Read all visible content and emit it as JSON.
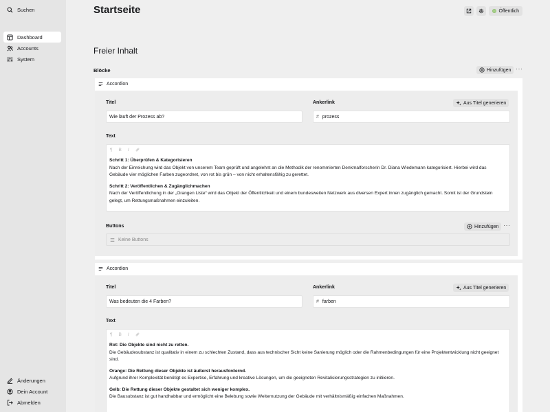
{
  "sidebar": {
    "search": "Suchen",
    "items": [
      {
        "label": "Dashboard",
        "icon": "dashboard-icon"
      },
      {
        "label": "Accounts",
        "icon": "users-icon"
      },
      {
        "label": "System",
        "icon": "settings-icon"
      }
    ],
    "bottom": [
      {
        "label": "Änderungen",
        "icon": "edit-icon"
      },
      {
        "label": "Dein Account",
        "icon": "user-icon"
      },
      {
        "label": "Abmelden",
        "icon": "logout-icon"
      }
    ]
  },
  "header": {
    "title": "Startseite",
    "status": "Öffentlich",
    "status_color": "#a7d18a"
  },
  "section": {
    "title": "Freier Inhalt",
    "blocks_label": "Blöcke",
    "add_label": "Hinzufügen"
  },
  "blocks": [
    {
      "type": "Accordion",
      "title_label": "Titel",
      "title_value": "Wie läuft der Prozess ab?",
      "anchor_label": "Ankerlink",
      "anchor_value": "prozess",
      "generate_label": "Aus Titel generieren",
      "text_label": "Text",
      "paragraphs": [
        {
          "heading": "Schritt 1: Überprüfen &  Kategorisieren",
          "body": "Nach der Einreichung wird das Objekt von unserem Team geprüft und angelehnt an die Methodik der renommierten Denkmalforscherin Dr. Diana Wiedemann kategorisiert. Hierbei wird das Gebäude vier möglichen Farben zugeordnet, von rot bis grün – von nicht erhaltensfähig zu gerettet."
        },
        {
          "heading": "Schritt 2:  Veröffentlichen &  Zugänglichmachen",
          "body": "Nach der Veröffentlichung in der „Orangen Liste“ wird das Objekt der Öffentlichkeit und einem bundesweiten Netzwerk aus diversen Expert:innen zugänglich gemacht. Somit ist der Grundstein gelegt, um Rettungsmaßnahmen einzuleiten."
        }
      ],
      "buttons_label": "Buttons",
      "buttons_add": "Hinzufügen",
      "buttons_empty": "Keine Buttons"
    },
    {
      "type": "Accordion",
      "title_label": "Titel",
      "title_value": "Was bedeuten die 4 Farben?",
      "anchor_label": "Ankerlink",
      "anchor_value": "farben",
      "generate_label": "Aus Titel generieren",
      "text_label": "Text",
      "paragraphs": [
        {
          "heading": "Rot: Die Objekte sind nicht zu retten.",
          "body": "Die Gebäudesubstanz ist qualitativ in einem zu schlechten Zustand, dass aus technischer Sicht keine Sanierung möglich oder die Rahmenbedingungen für eine Projektentwicklung nicht geeignet sind."
        },
        {
          "heading": "Orange: Die Rettung dieser Objekte ist äußerst herausfordernd.",
          "body": "Aufgrund ihrer Komplexität benötigt es Expertise, Erfahrung und kreative Lösungen, um die geeigneten Revitalisierungsstrategien zu initiieren."
        },
        {
          "heading": "Gelb: Die Rettung dieser Objekte gestaltet sich weniger komplex.",
          "body": "Die Bausubstanz ist gut handhabbar und ermöglicht eine Belebung sowie Weiternutzung der Gebäude mit verhältnismäßig einfachen Maßnahmen."
        }
      ]
    }
  ]
}
